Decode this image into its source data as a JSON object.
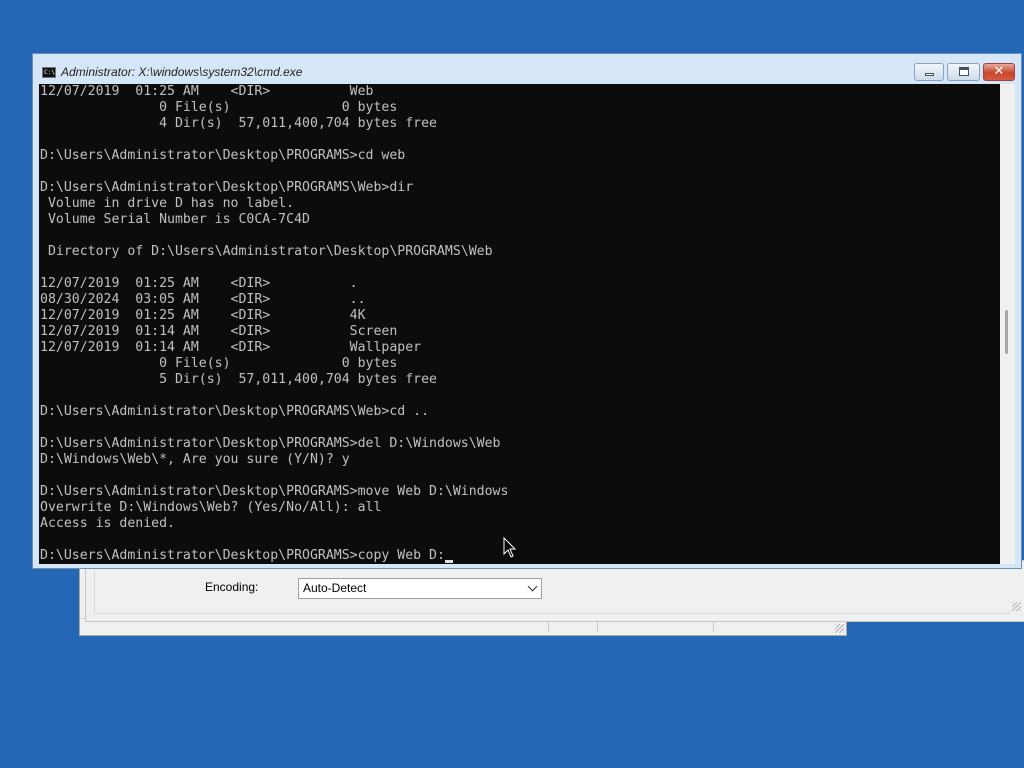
{
  "background_dialog": {
    "encoding_label": "Encoding:",
    "encoding_value": "Auto-Detect"
  },
  "cmd": {
    "title": "Administrator: X:\\windows\\system32\\cmd.exe",
    "icon_label": "C:\\",
    "lines": [
      "12/07/2019  01:25 AM    <DIR>          Web",
      "               0 File(s)              0 bytes",
      "               4 Dir(s)  57,011,400,704 bytes free",
      "",
      "D:\\Users\\Administrator\\Desktop\\PROGRAMS>cd web",
      "",
      "D:\\Users\\Administrator\\Desktop\\PROGRAMS\\Web>dir",
      " Volume in drive D has no label.",
      " Volume Serial Number is C0CA-7C4D",
      "",
      " Directory of D:\\Users\\Administrator\\Desktop\\PROGRAMS\\Web",
      "",
      "12/07/2019  01:25 AM    <DIR>          .",
      "08/30/2024  03:05 AM    <DIR>          ..",
      "12/07/2019  01:25 AM    <DIR>          4K",
      "12/07/2019  01:14 AM    <DIR>          Screen",
      "12/07/2019  01:14 AM    <DIR>          Wallpaper",
      "               0 File(s)              0 bytes",
      "               5 Dir(s)  57,011,400,704 bytes free",
      "",
      "D:\\Users\\Administrator\\Desktop\\PROGRAMS\\Web>cd ..",
      "",
      "D:\\Users\\Administrator\\Desktop\\PROGRAMS>del D:\\Windows\\Web",
      "D:\\Windows\\Web\\*, Are you sure (Y/N)? y",
      "",
      "D:\\Users\\Administrator\\Desktop\\PROGRAMS>move Web D:\\Windows",
      "Overwrite D:\\Windows\\Web? (Yes/No/All): all",
      "Access is denied.",
      "",
      "D:\\Users\\Administrator\\Desktop\\PROGRAMS>copy Web D:"
    ],
    "buttons": {
      "minimize": "minimize-icon",
      "maximize": "maximize-icon",
      "close": "✕"
    }
  },
  "colors": {
    "desktop": "#2467b4",
    "console_bg": "#0c0c0c",
    "console_text": "#c0c0c0",
    "frame": "#d4e6f8"
  }
}
